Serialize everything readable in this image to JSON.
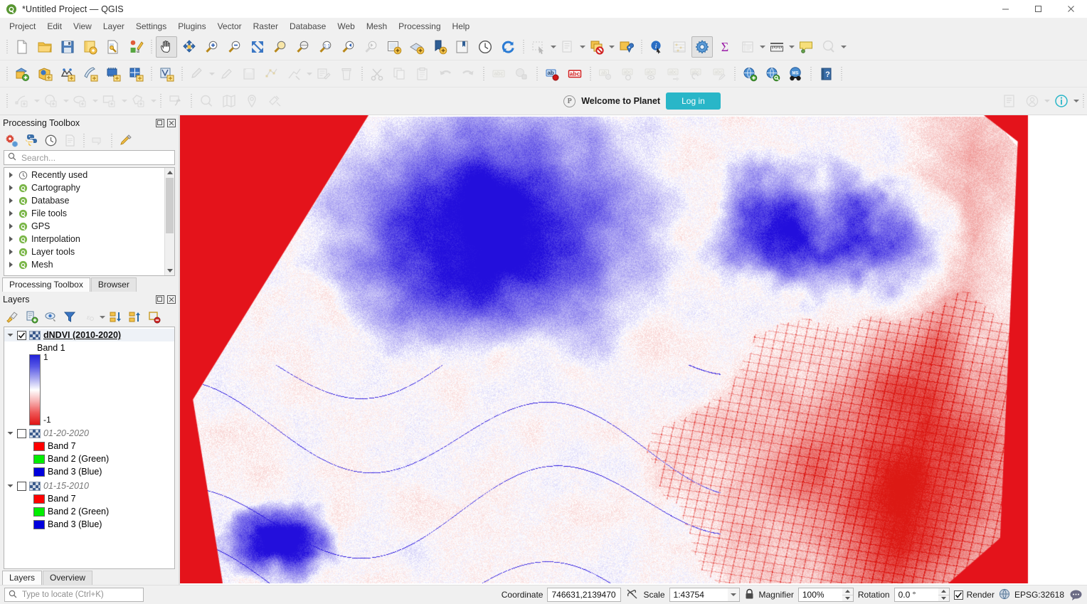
{
  "window": {
    "title": "*Untitled Project — QGIS",
    "app_icon": "qgis-logo-icon",
    "minimize": "—",
    "maximize": "▢",
    "close": "✕"
  },
  "menubar": {
    "items": [
      {
        "label": "Project"
      },
      {
        "label": "Edit"
      },
      {
        "label": "View"
      },
      {
        "label": "Layer"
      },
      {
        "label": "Settings"
      },
      {
        "label": "Plugins"
      },
      {
        "label": "Vector"
      },
      {
        "label": "Raster"
      },
      {
        "label": "Database"
      },
      {
        "label": "Web"
      },
      {
        "label": "Mesh"
      },
      {
        "label": "Processing"
      },
      {
        "label": "Help"
      }
    ]
  },
  "toolbar_project": {
    "buttons": [
      {
        "name": "new-project-icon"
      },
      {
        "name": "open-project-icon"
      },
      {
        "name": "save-project-icon"
      },
      {
        "name": "save-project-as-icon"
      },
      {
        "name": "new-print-layout-icon"
      },
      {
        "name": "style-manager-icon"
      },
      {
        "name": "pan-map-icon"
      },
      {
        "name": "pan-to-selection-icon"
      },
      {
        "name": "zoom-in-icon"
      },
      {
        "name": "zoom-out-icon"
      },
      {
        "name": "zoom-full-icon"
      },
      {
        "name": "zoom-to-selection-icon"
      },
      {
        "name": "zoom-to-layer-icon"
      },
      {
        "name": "zoom-native-resolution-icon"
      },
      {
        "name": "zoom-last-icon"
      },
      {
        "name": "zoom-next-icon"
      },
      {
        "name": "new-map-view-icon"
      },
      {
        "name": "new-3d-map-view-icon"
      },
      {
        "name": "refresh-bookmark-icon"
      },
      {
        "name": "show-bookmarks-icon"
      },
      {
        "name": "temporal-controller-icon"
      },
      {
        "name": "refresh-icon"
      },
      {
        "name": "select-features-icon"
      },
      {
        "name": "select-value-icon"
      },
      {
        "name": "deselect-features-icon"
      },
      {
        "name": "select-by-location-icon"
      },
      {
        "name": "identify-features-icon"
      },
      {
        "name": "statistical-summary-icon"
      },
      {
        "name": "processing-toolbox-icon"
      },
      {
        "name": "field-calculator-icon"
      },
      {
        "name": "attribute-table-icon"
      },
      {
        "name": "measure-line-icon"
      },
      {
        "name": "map-tips-icon"
      },
      {
        "name": "spatial-bookmarks-icon"
      }
    ]
  },
  "toolbar_data": {
    "buttons": [
      {
        "name": "open-data-source-manager-icon"
      },
      {
        "name": "add-vector-layer-icon"
      },
      {
        "name": "add-raster-layer-icon"
      },
      {
        "name": "add-mesh-layer-icon"
      },
      {
        "name": "add-delimited-text-layer-icon"
      },
      {
        "name": "add-postgis-layer-icon"
      },
      {
        "name": "add-virtual-layer-icon"
      },
      {
        "name": "current-edits-icon"
      },
      {
        "name": "toggle-editing-icon"
      },
      {
        "name": "save-layer-edits-icon"
      },
      {
        "name": "vertex-tool-icon"
      },
      {
        "name": "digitizing-tools-icon"
      },
      {
        "name": "modify-attributes-icon"
      },
      {
        "name": "delete-selected-icon"
      },
      {
        "name": "cut-features-icon"
      },
      {
        "name": "copy-features-icon"
      },
      {
        "name": "paste-features-icon"
      },
      {
        "name": "undo-icon"
      },
      {
        "name": "redo-icon"
      },
      {
        "name": "label-toolbar-icon"
      },
      {
        "name": "pin-labels-icon"
      },
      {
        "name": "highlight-pinned-labels-icon"
      },
      {
        "name": "show-hide-labels-icon"
      },
      {
        "name": "move-label-icon"
      },
      {
        "name": "rotate-label-icon"
      },
      {
        "name": "change-label-icon"
      },
      {
        "name": "metasearch-icon"
      },
      {
        "name": "add-wms-layer-icon"
      },
      {
        "name": "wms-search-icon"
      },
      {
        "name": "georeferencer-icon"
      },
      {
        "name": "help-contents-icon"
      }
    ]
  },
  "toolbar_digitizing": {
    "buttons": [
      {
        "name": "add-point-feature-icon"
      },
      {
        "name": "add-circle-feature-icon"
      },
      {
        "name": "add-ellipse-feature-icon"
      },
      {
        "name": "add-rectangle-feature-icon"
      },
      {
        "name": "add-polygon-feature-icon"
      },
      {
        "name": "trim-extend-feature-icon"
      },
      {
        "name": "search-geometry-icon"
      },
      {
        "name": "osm-map-icon"
      },
      {
        "name": "geocoding-icon"
      },
      {
        "name": "satellite-imagery-icon"
      },
      {
        "name": "order-log-icon"
      },
      {
        "name": "user-account-icon"
      },
      {
        "name": "about-info-icon"
      }
    ]
  },
  "planet_bar": {
    "logo": "planet-logo-icon",
    "message": "Welcome to Planet",
    "login_label": "Log in",
    "accent_color": "#29b6c8"
  },
  "processing_panel": {
    "title": "Processing Toolbox",
    "float_icon": "float-panel-icon",
    "close_icon": "close-panel-icon",
    "tools": [
      {
        "name": "models-icon"
      },
      {
        "name": "scripts-icon"
      },
      {
        "name": "history-icon"
      },
      {
        "name": "results-viewer-icon"
      },
      {
        "name": "edit-features-in-place-icon"
      },
      {
        "name": "options-icon"
      }
    ],
    "search": {
      "placeholder": "Search...",
      "value": "",
      "icon": "search-icon"
    },
    "tree": [
      {
        "label": "Recently used",
        "icon": "clock-icon"
      },
      {
        "label": "Cartography",
        "icon": "qgis-provider-icon"
      },
      {
        "label": "Database",
        "icon": "qgis-provider-icon"
      },
      {
        "label": "File tools",
        "icon": "qgis-provider-icon"
      },
      {
        "label": "GPS",
        "icon": "qgis-provider-icon"
      },
      {
        "label": "Interpolation",
        "icon": "qgis-provider-icon"
      },
      {
        "label": "Layer tools",
        "icon": "qgis-provider-icon"
      },
      {
        "label": "Mesh",
        "icon": "qgis-provider-icon"
      }
    ],
    "tabs": [
      {
        "label": "Processing Toolbox",
        "selected": true
      },
      {
        "label": "Browser",
        "selected": false
      }
    ]
  },
  "layers_panel": {
    "title": "Layers",
    "float_icon": "float-panel-icon",
    "close_icon": "close-panel-icon",
    "tools": [
      {
        "name": "open-layer-styling-panel-icon"
      },
      {
        "name": "add-group-icon"
      },
      {
        "name": "manage-map-themes-icon"
      },
      {
        "name": "filter-legend-icon"
      },
      {
        "name": "filter-legend-by-expression-icon"
      },
      {
        "name": "expand-all-icon"
      },
      {
        "name": "collapse-all-icon"
      },
      {
        "name": "remove-layer-icon"
      }
    ],
    "layers": [
      {
        "name": "dNDVI (2010-2020)",
        "checked": true,
        "selected": true,
        "expanded": true,
        "style": "active",
        "band_label": "Band 1",
        "ramp": {
          "max_label": "1",
          "min_label": "-1",
          "colors": [
            "#2222d8",
            "#5858e6",
            "#a8a8f0",
            "#ffffff",
            "#f7b0b0",
            "#ee5555",
            "#e01515"
          ]
        }
      },
      {
        "name": "01-20-2020",
        "checked": false,
        "selected": false,
        "expanded": true,
        "style": "off",
        "bands": [
          {
            "label": "Band 7",
            "color": "#ff0000"
          },
          {
            "label": "Band 2 (Green)",
            "color": "#00ee00"
          },
          {
            "label": "Band 3 (Blue)",
            "color": "#0000dd"
          }
        ]
      },
      {
        "name": "01-15-2010",
        "checked": false,
        "selected": false,
        "expanded": true,
        "style": "off",
        "bands": [
          {
            "label": "Band 7",
            "color": "#ff0000"
          },
          {
            "label": "Band 2 (Green)",
            "color": "#00ee00"
          },
          {
            "label": "Band 3 (Blue)",
            "color": "#0000dd"
          }
        ]
      }
    ],
    "tabs": [
      {
        "label": "Layers",
        "selected": true
      },
      {
        "label": "Overview",
        "selected": false
      }
    ]
  },
  "map": {
    "nodata_color": "#e4131b",
    "background_color": "#ffffff",
    "description": "dNDVI difference raster, blue-white-red diverging ramp, diagonal nodata edges"
  },
  "statusbar": {
    "locator": {
      "placeholder": "Type to locate (Ctrl+K)",
      "value": "",
      "icon": "search-icon"
    },
    "coordinate_label": "Coordinate",
    "coordinate_value": "746631,2139470",
    "toggle_extents_icon": "toggle-extents-icon",
    "scale_label": "Scale",
    "scale_value": "1:43754",
    "scale_lock_icon": "lock-icon",
    "magnifier_label": "Magnifier",
    "magnifier_value": "100%",
    "rotation_label": "Rotation",
    "rotation_value": "0.0 °",
    "render_label": "Render",
    "render_checked": true,
    "crs_label": "EPSG:32618",
    "crs_icon": "globe-icon",
    "messages_icon": "messages-icon"
  }
}
